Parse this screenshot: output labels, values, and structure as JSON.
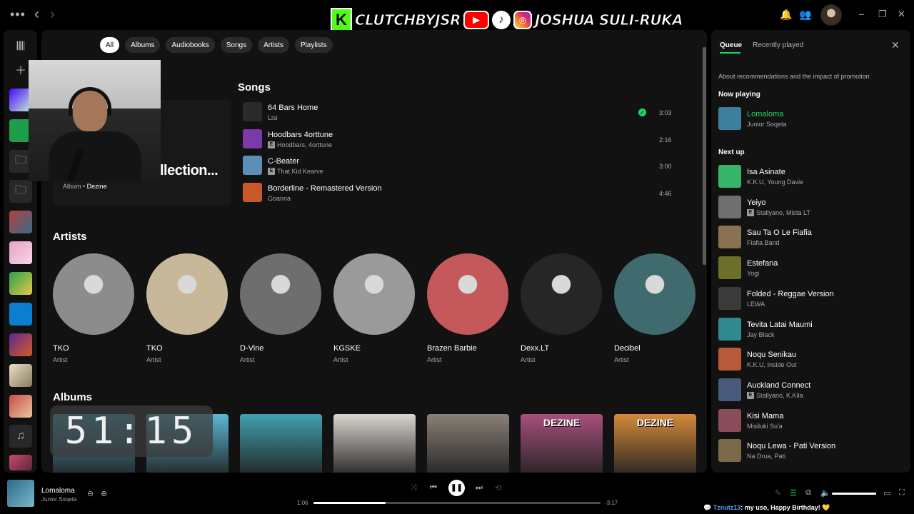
{
  "banner": {
    "kick_letter": "K",
    "kick_name": "CLUTCHBYJSR",
    "youtube_glyph": "▶",
    "tiktok_glyph": "♪",
    "instagram_glyph": "◎",
    "social_name": "JOSHUA SULI-RUKA"
  },
  "topbar": {
    "menu_icon": "more-horizontal-icon",
    "back_icon": "chevron-left-icon",
    "forward_icon": "chevron-right-icon"
  },
  "filters": [
    "All",
    "Albums",
    "Audiobooks",
    "Songs",
    "Artists",
    "Playlists"
  ],
  "top_result": {
    "title": "llection...",
    "type": "Album",
    "artist": "Dezine"
  },
  "songs_heading": "Songs",
  "songs": [
    {
      "title": "64 Bars Home",
      "artist": "Lisi",
      "explicit": false,
      "saved": true,
      "duration": "3:03",
      "art_color": "#2a2a2a"
    },
    {
      "title": "Hoodbars 4orttune",
      "artist": "Hoodbars, 4orttune",
      "explicit": true,
      "saved": false,
      "duration": "2:16",
      "art_color": "#7a3aa8"
    },
    {
      "title": "C-Beater",
      "artist": "That Kid Kearve",
      "explicit": true,
      "saved": false,
      "duration": "3:00",
      "art_color": "#5b8fb5"
    },
    {
      "title": "Borderline - Remastered Version",
      "artist": "Goanna",
      "explicit": false,
      "saved": false,
      "duration": "4:46",
      "art_color": "#c6582a"
    }
  ],
  "explicit_label": "E",
  "artists_heading": "Artists",
  "artists": [
    {
      "name": "TKO",
      "type": "Artist",
      "color": "#8c8c8c"
    },
    {
      "name": "TKO",
      "type": "Artist",
      "color": "#c8b89a"
    },
    {
      "name": "D-Vine",
      "type": "Artist",
      "color": "#6e6e6e"
    },
    {
      "name": "KGSKE",
      "type": "Artist",
      "color": "#9a9a9a"
    },
    {
      "name": "Brazen Barbie",
      "type": "Artist",
      "color": "#c4585a"
    },
    {
      "name": "Dexx.LT",
      "type": "Artist",
      "color": "#262626"
    },
    {
      "name": "Decibel",
      "type": "Artist",
      "color": "#3f6a6e"
    }
  ],
  "albums_heading": "Albums",
  "albums": [
    {
      "color": "#4aa6c9"
    },
    {
      "color": "#5bb8d4"
    },
    {
      "color": "#3fa0b0"
    },
    {
      "color": "#d9d6d0"
    },
    {
      "color": "#8a8077"
    },
    {
      "color": "#a94f7d",
      "label": "DEZINE"
    },
    {
      "color": "#d48a3a",
      "label": "DEZINE"
    }
  ],
  "timer": "51:15",
  "queue": {
    "tabs": [
      "Queue",
      "Recently played"
    ],
    "about": "About recommendations and the impact of promotion",
    "now_playing_heading": "Now playing",
    "now_playing": {
      "title": "Lomaloma",
      "artist": "Junior Soqeta",
      "color": "#3d7f9c"
    },
    "next_up_heading": "Next up",
    "next_up": [
      {
        "title": "Isa Asinate",
        "artist": "K.K.U, Young Davie",
        "explicit": false,
        "color": "#36b56a"
      },
      {
        "title": "Yeiyo",
        "artist": "Stallyano, Mista LT",
        "explicit": true,
        "color": "#6f6f6f"
      },
      {
        "title": "Sau Ta O Le Fiafia",
        "artist": "Fiafia Band",
        "explicit": false,
        "color": "#8a7250"
      },
      {
        "title": "Estefana",
        "artist": "Yogi",
        "explicit": false,
        "color": "#6c6f28"
      },
      {
        "title": "Folded - Reggae Version",
        "artist": "LEWA",
        "explicit": false,
        "color": "#3a3a3a"
      },
      {
        "title": "Tevita Latai Maumi",
        "artist": "Jay Black",
        "explicit": false,
        "color": "#2f8a8f"
      },
      {
        "title": "Noqu Senikau",
        "artist": "K.K.U, Inside Out",
        "explicit": false,
        "color": "#b85a3a"
      },
      {
        "title": "Auckland Connect",
        "artist": "Stallyano, K.Kila",
        "explicit": true,
        "color": "#4a5a7a"
      },
      {
        "title": "Kisi Mama",
        "artist": "Misiluki Su'a",
        "explicit": false,
        "color": "#8a4e5a"
      },
      {
        "title": "Noqu Lewa - Pati Version",
        "artist": "Na Drua, Pati",
        "explicit": false,
        "color": "#7a6a4a"
      }
    ]
  },
  "player": {
    "title": "Lomaloma",
    "artist": "Junior Soqeta",
    "elapsed": "1:06",
    "remaining": "-3:17",
    "progress": 0.25,
    "volume": 1.0
  },
  "chat": {
    "user": "Tznutz13",
    "message": ": my uso, Happy Birthday! 💛"
  },
  "colors": {
    "accent": "#1ed760",
    "background": "#000000",
    "panel": "#121212"
  }
}
